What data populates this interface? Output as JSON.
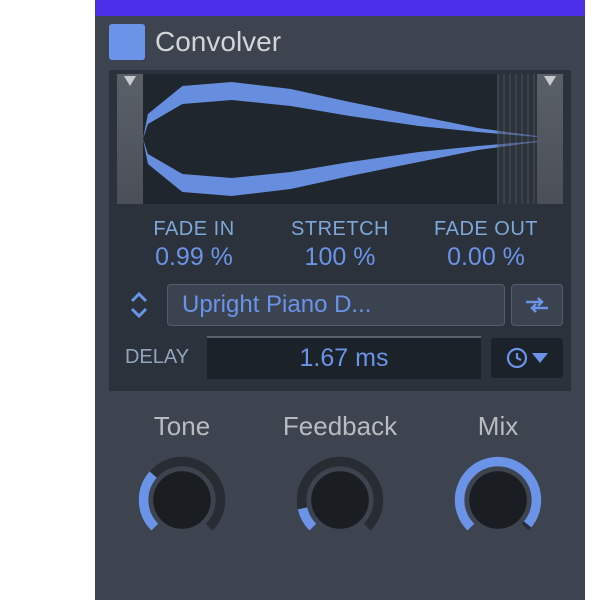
{
  "header": {
    "title": "Convolver"
  },
  "params": {
    "fade_in": {
      "label": "FADE IN",
      "value": "0.99 %"
    },
    "stretch": {
      "label": "STRETCH",
      "value": "100 %"
    },
    "fade_out": {
      "label": "FADE OUT",
      "value": "0.00 %"
    }
  },
  "sample": {
    "name": "Upright Piano D..."
  },
  "delay": {
    "label": "DELAY",
    "value": "1.67 ms"
  },
  "knobs": {
    "tone": {
      "label": "Tone",
      "amount": 0.32,
      "start": -135
    },
    "feedback": {
      "label": "Feedback",
      "amount": 0.12,
      "start": -135
    },
    "mix": {
      "label": "Mix",
      "amount": 0.98,
      "start": -135
    }
  },
  "colors": {
    "accent": "#6b93e8"
  }
}
